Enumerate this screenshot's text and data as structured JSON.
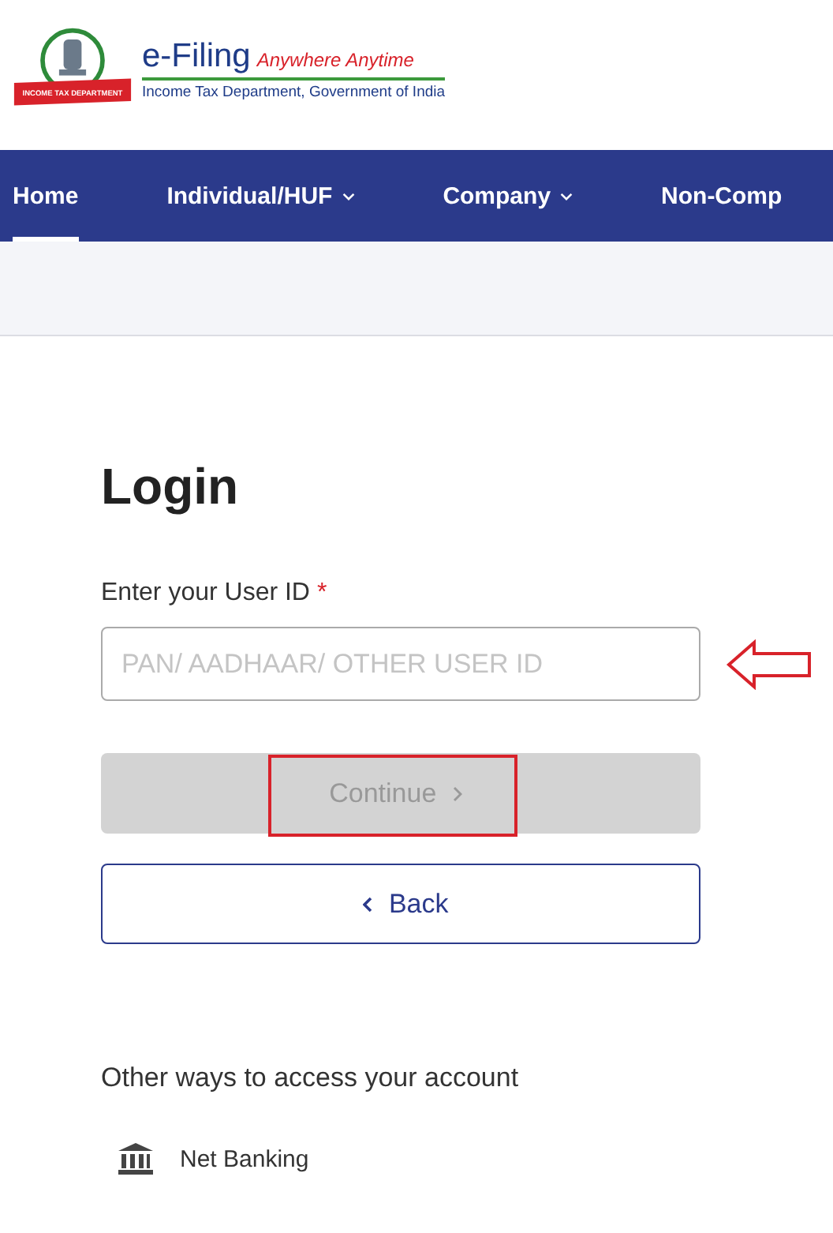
{
  "header": {
    "brand": "e-Filing",
    "tagline": "Anywhere Anytime",
    "subtitle": "Income Tax Department, Government of India",
    "ribbon": "INCOME TAX DEPARTMENT"
  },
  "nav": [
    {
      "label": "Home",
      "selected": true,
      "dropdown": false
    },
    {
      "label": "Individual/HUF",
      "selected": false,
      "dropdown": true
    },
    {
      "label": "Company",
      "selected": false,
      "dropdown": true
    },
    {
      "label": "Non-Comp",
      "selected": false,
      "dropdown": false
    }
  ],
  "login": {
    "title": "Login",
    "field_label": "Enter your User ID",
    "required_mark": "*",
    "placeholder": "PAN/ AADHAAR/ OTHER USER ID",
    "continue": {
      "label": "Continue",
      "disabled": true
    },
    "back": {
      "label": "Back"
    }
  },
  "other_ways": {
    "heading": "Other ways to access your account",
    "items": [
      {
        "label": "Net Banking"
      }
    ]
  }
}
